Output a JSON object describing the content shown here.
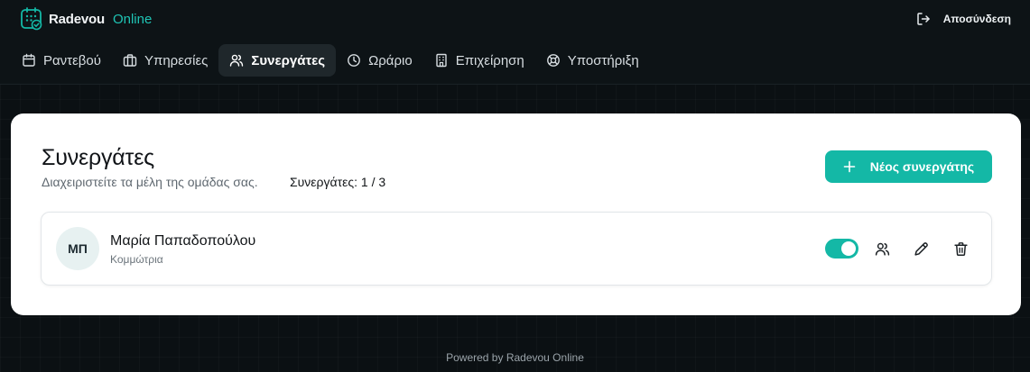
{
  "brand": {
    "name": "Radevou",
    "suffix": "Online",
    "accent": "#14b8a6"
  },
  "header": {
    "logout_label": "Αποσύνδεση"
  },
  "nav": {
    "items": [
      {
        "label": "Ραντεβού",
        "icon": "calendar-icon"
      },
      {
        "label": "Υπηρεσίες",
        "icon": "briefcase-icon"
      },
      {
        "label": "Συνεργάτες",
        "icon": "users-icon",
        "active": true
      },
      {
        "label": "Ωράριο",
        "icon": "clock-icon"
      },
      {
        "label": "Επιχείρηση",
        "icon": "building-icon"
      },
      {
        "label": "Υποστήριξη",
        "icon": "lifebuoy-icon"
      }
    ]
  },
  "main": {
    "title": "Συνεργάτες",
    "subtitle": "Διαχειριστείτε τα μέλη της ομάδας σας.",
    "count_label": "Συνεργάτες: 1 / 3",
    "new_button_label": "Νέος συνεργάτης",
    "members": [
      {
        "initials": "ΜΠ",
        "name": "Μαρία Παπαδοπούλου",
        "role": "Κομμώτρια",
        "active": true
      }
    ]
  },
  "footer": {
    "text": "Powered by Radevou Online"
  }
}
